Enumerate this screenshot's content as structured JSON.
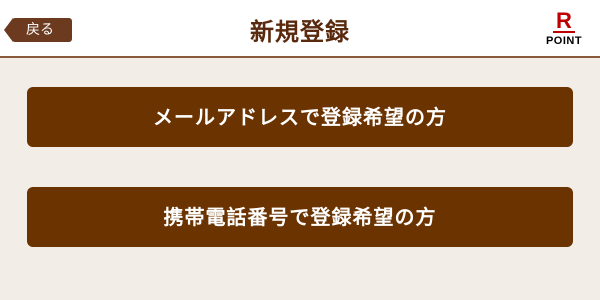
{
  "header": {
    "back_label": "戻る",
    "title": "新規登録",
    "logo": {
      "letter": "R",
      "text": "POINT",
      "color": "#bf0000"
    }
  },
  "options": {
    "email_label": "メールアドレスで登録希望の方",
    "phone_label": "携帯電話番号で登録希望の方"
  },
  "colors": {
    "background": "#f2ede6",
    "button": "#6b3300",
    "title": "#5a2a0f"
  }
}
